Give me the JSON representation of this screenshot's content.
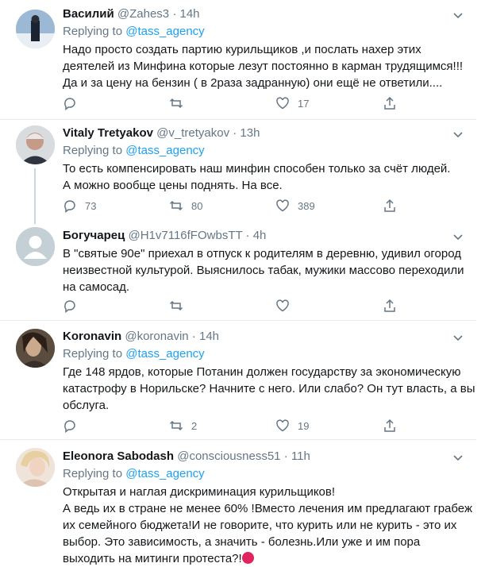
{
  "colors": {
    "accent": "#1da1f2",
    "muted": "#657786",
    "text": "#14171a",
    "border": "#e6ecf0"
  },
  "tweets": [
    {
      "name": "Василий",
      "handle": "@Zahes3",
      "dot": "·",
      "time": "14h",
      "replying_prefix": "Replying to",
      "replying_to": "@tass_agency",
      "lines": [
        "Надо просто создать партию курильщиков ,и послать нахер этих",
        "деятелей из Минфина которые лезут постоянно в карман трудящимся!!!",
        "Да и за цену на бензин ( в 2раза задранную) они ещё не ответили...."
      ],
      "replies": "",
      "retweets": "",
      "likes": "17"
    },
    {
      "name": "Vitaly Tretyakov",
      "handle": "@v_tretyakov",
      "dot": "·",
      "time": "13h",
      "replying_prefix": "Replying to",
      "replying_to": "@tass_agency",
      "lines": [
        "То есть компенсировать наш минфин способен только за счёт людей.",
        "А можно вообще цены поднять. На все."
      ],
      "replies": "73",
      "retweets": "80",
      "likes": "389"
    },
    {
      "name": "Богучарец",
      "handle": "@H1v7116fFOwbsTT",
      "dot": "·",
      "time": "4h",
      "lines": [
        "В \"святые 90е\" приехал в отпуск к родителям в деревню, удивил огород",
        "неизвестной культурой. Выяснилось табак, мужики массово переходили",
        "на самосад."
      ],
      "replies": "",
      "retweets": "",
      "likes": ""
    },
    {
      "name": "Koronavin",
      "handle": "@koronavin",
      "dot": "·",
      "time": "14h",
      "replying_prefix": "Replying to",
      "replying_to": "@tass_agency",
      "lines": [
        "Где 148 ярдов, которые Потанин должен государству за экономическую",
        "катастрофу в Норильске? Начните с него. Или слабо? Он тут власть, а вы",
        "обслуга."
      ],
      "replies": "",
      "retweets": "2",
      "likes": "19"
    },
    {
      "name": "Eleonora Sabodash",
      "handle": "@consciousness51",
      "dot": "·",
      "time": "11h",
      "replying_prefix": "Replying to",
      "replying_to": "@tass_agency",
      "lines": [
        "Открытая и наглая дискриминация курильщиков!",
        "А ведь их в стране не менее 60% !Вместо лечения им предлагают грабеж",
        "их семейного бюджета!И не говорите, что курить или не курить - это их",
        "выбор. Это зависимость, а значить - болезнь.Или уже и им пора",
        "выходить на митинги протеста?!"
      ],
      "emoji_name": "angry-face-icon"
    }
  ]
}
